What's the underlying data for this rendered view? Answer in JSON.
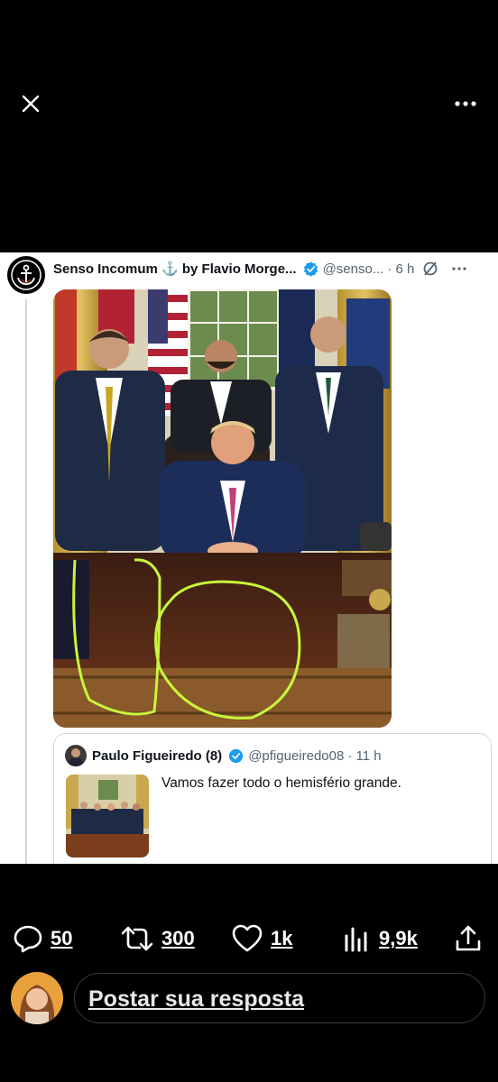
{
  "viewer": {
    "close_icon": "close-icon",
    "more_icon": "more-dots-icon"
  },
  "tweet": {
    "author": "Senso Incomum ⚓ by Flavio Morge...",
    "handle": "@senso...",
    "time": "· 6 h",
    "verified_color": "#1d9bf0"
  },
  "quote": {
    "author": "Paulo Figueiredo (8)",
    "handle": "@pfigueiredo08",
    "time": "· 11 h",
    "text": "Vamos fazer todo o hemisfério grande."
  },
  "actions": {
    "replies": "50",
    "reposts": "300",
    "likes": "1k",
    "views": "9,9k"
  },
  "reply": {
    "placeholder": "Postar sua resposta"
  },
  "colors": {
    "highlight": "#c8f53c",
    "accent": "#1d9bf0"
  }
}
